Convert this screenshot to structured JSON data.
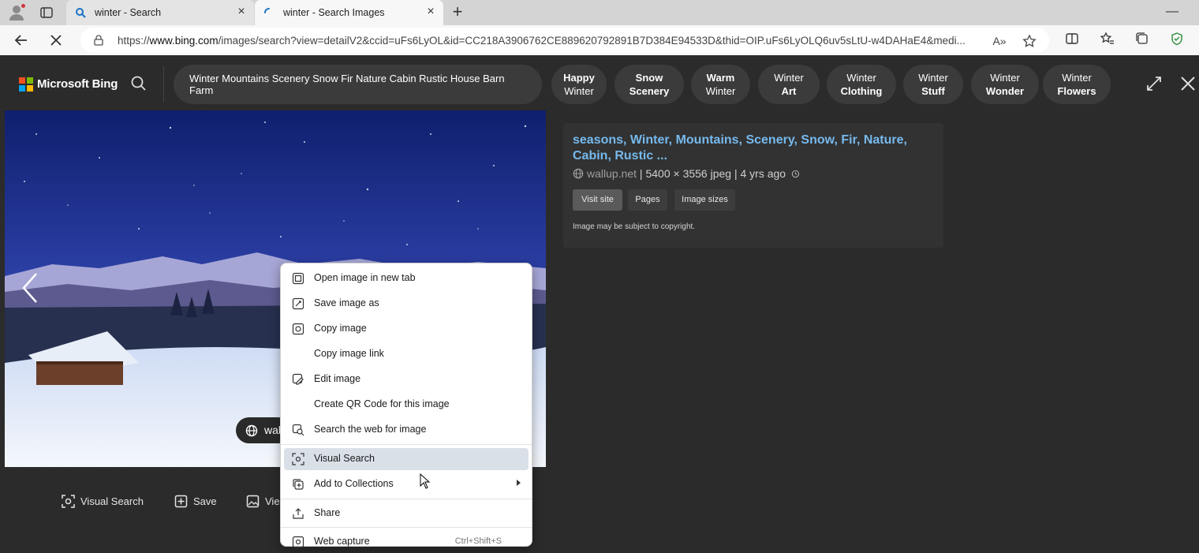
{
  "browser": {
    "tabs": [
      {
        "title": "winter - Search",
        "state": "inactive"
      },
      {
        "title": "winter - Search Images",
        "state": "active-loading"
      }
    ],
    "url_prefix": "https://",
    "url_domain": "www.bing.com",
    "url_path": "/images/search?view=detailV2&ccid=uFs6LyOL&id=CC218A3906762CE889620792891B7D384E94533D&thid=OIP.uFs6LyOLQ6uv5sLtU-w4DAHaE4&medi..."
  },
  "bing": {
    "logo_text": "Microsoft Bing",
    "query": "Winter Mountains Scenery Snow Fir Nature Cabin Rustic House Barn Farm",
    "related": [
      {
        "line1": "Happy",
        "line2": "Winter"
      },
      {
        "line1": "Snow",
        "line2": "Scenery"
      },
      {
        "line1": "Warm",
        "line2": "Winter"
      },
      {
        "line1": "Winter",
        "line2": "Art"
      },
      {
        "line1": "Winter",
        "line2": "Clothing"
      },
      {
        "line1": "Winter",
        "line2": "Stuff"
      },
      {
        "line1": "Winter",
        "line2": "Wonder"
      },
      {
        "line1": "Winter",
        "line2": "Flowers"
      }
    ]
  },
  "image": {
    "source_chip": "wal",
    "toolbar": {
      "visual_search": "Visual Search",
      "save": "Save",
      "view": "Vie"
    }
  },
  "info": {
    "title": "seasons, Winter, Mountains, Scenery, Snow, Fir, Nature, Cabin, Rustic ...",
    "domain": "wallup.net",
    "dimensions": "5400 × 3556 jpeg",
    "age": "4 yrs ago",
    "buttons": {
      "visit": "Visit site",
      "pages": "Pages",
      "sizes": "Image sizes"
    },
    "copyright": "Image may be subject to copyright."
  },
  "context_menu": {
    "items": [
      {
        "label": "Open image in new tab",
        "icon": "new-tab-icon"
      },
      {
        "label": "Save image as",
        "icon": "save-image-icon"
      },
      {
        "label": "Copy image",
        "icon": "copy-image-icon"
      },
      {
        "label": "Copy image link",
        "icon": ""
      },
      {
        "label": "Edit image",
        "icon": "edit-image-icon"
      },
      {
        "label": "Create QR Code for this image",
        "icon": ""
      },
      {
        "label": "Search the web for image",
        "icon": "image-search-icon"
      },
      {
        "label": "Visual Search",
        "icon": "visual-search-icon",
        "highlighted": true
      },
      {
        "label": "Add to Collections",
        "icon": "collections-icon",
        "submenu": true
      },
      {
        "label": "Share",
        "icon": "share-icon"
      },
      {
        "label": "Web capture",
        "icon": "web-capture-icon",
        "shortcut": "Ctrl+Shift+S"
      }
    ]
  },
  "colors": {
    "accent_link": "#76b9ed",
    "overlay_bg": "#2b2b2b",
    "menu_highlight": "#d9e0e8"
  }
}
